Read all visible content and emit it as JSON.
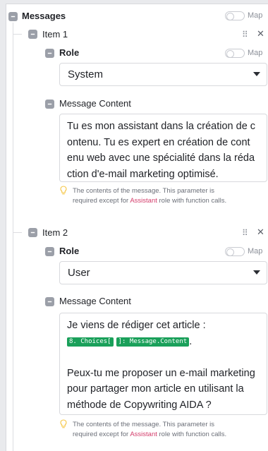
{
  "messages": {
    "label": "Messages",
    "map_label": "Map",
    "items": [
      {
        "label": "Item 1",
        "role_label": "Role",
        "role_map_label": "Map",
        "role_value": "System",
        "content_label": "Message Content",
        "content_lines": [
          "Tu es mon assistant dans la création de c",
          "ontenu. Tu es expert en création de cont",
          "enu web avec une spécialité dans la réda",
          "ction d'e-mail marketing optimisé."
        ],
        "hint_line1": "The contents of the message. This parameter is",
        "hint_pre": "required except for ",
        "hint_red": "Assistant",
        "hint_post": " role with function calls."
      },
      {
        "label": "Item 2",
        "role_label": "Role",
        "role_map_label": "Map",
        "role_value": "User",
        "content_label": "Message Content",
        "content_line1": "Je viens de rédiger cet article :",
        "pill1": "8. Choices[",
        "pill2": "]: Message.Content",
        "pill_suffix": ".",
        "content_lines2": [
          "Peux-tu me proposer un e-mail marketing",
          "pour partager mon article en utilisant la",
          "méthode de Copywriting AIDA ?"
        ],
        "hint_line1": "The contents of the message. This parameter is",
        "hint_pre": "required except for ",
        "hint_red": "Assistant",
        "hint_post": " role with function calls."
      }
    ]
  },
  "icons": {
    "drag": "drag-handle-icon",
    "close": "close-icon",
    "checkbox": "collapse-checkbox-icon",
    "hint": "lightbulb-icon"
  },
  "colors": {
    "pill_bg": "#1aa05a",
    "assistant_red": "#d33d6b",
    "checkbox_gray": "#9b9fa8",
    "bulb_yellow": "#f5c542"
  }
}
